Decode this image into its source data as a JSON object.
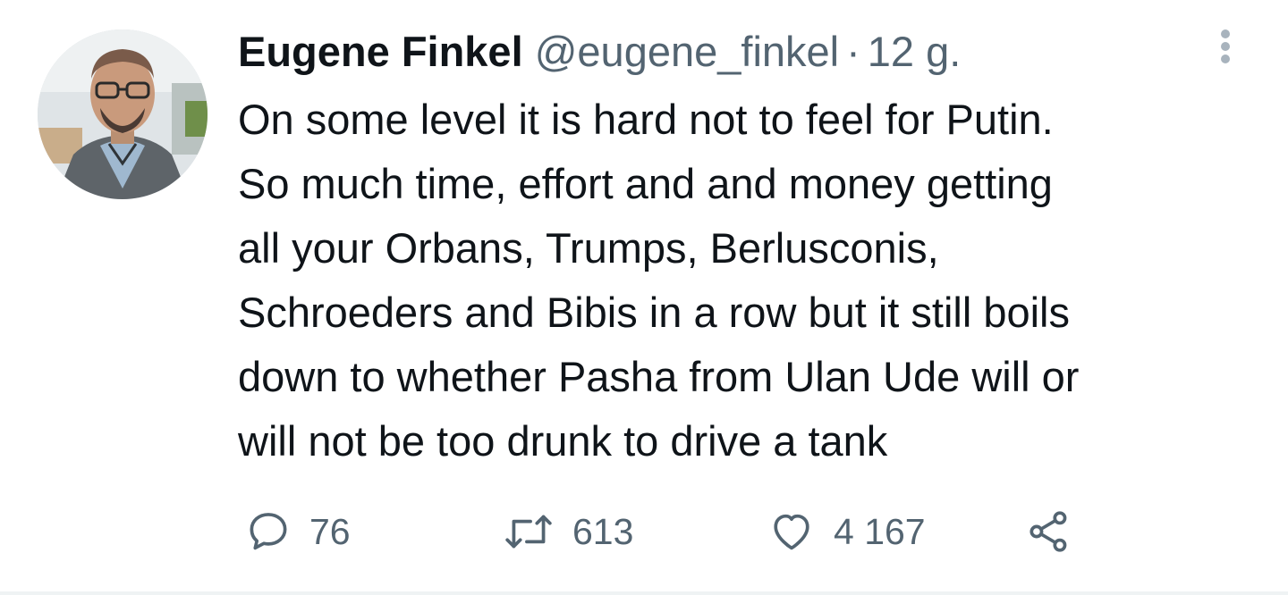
{
  "tweet": {
    "author_name": "Eugene Finkel",
    "handle": "@eugene_finkel",
    "separator": "·",
    "time": "12 g.",
    "text_lines": [
      "On some level it is hard not to feel for Putin.",
      "So much time, effort and and money getting",
      "all your Orbans, Trumps, Berlusconis,",
      "Schroeders and Bibis in a row but it still boils",
      "down to whether Pasha from Ulan Ude will or",
      "will not be too drunk to drive a tank"
    ],
    "counts": {
      "replies": "76",
      "retweets": "613",
      "likes": "4 167"
    }
  },
  "icons": {
    "avatar": "profile-photo",
    "more": "more-vertical-icon",
    "reply": "reply-bubble-icon",
    "retweet": "retweet-icon",
    "like": "heart-icon",
    "share": "share-icon"
  },
  "colors": {
    "text": "#0f1419",
    "muted": "#536471",
    "more_dots": "#a8b3bd",
    "divider": "#eff3f4"
  }
}
